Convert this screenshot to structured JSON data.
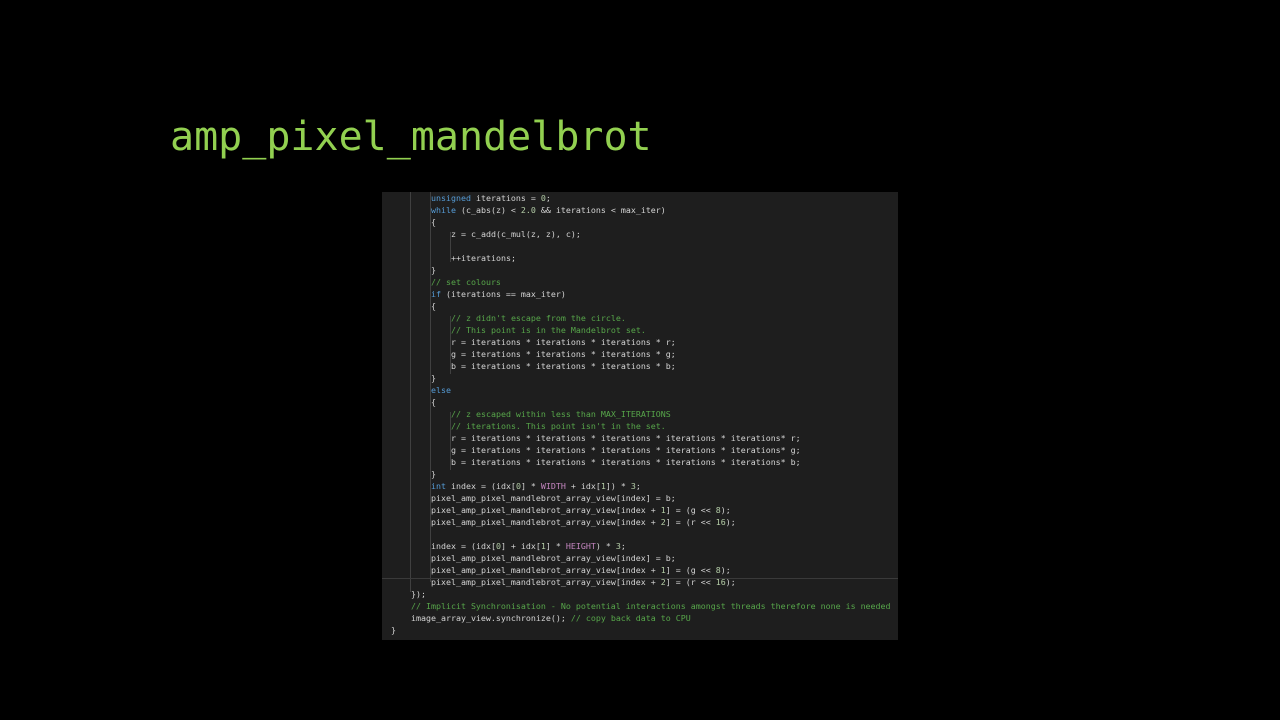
{
  "slide": {
    "title": "amp_pixel_mandelbrot"
  },
  "code": {
    "lines": [
      {
        "indent": 2,
        "tokens": [
          {
            "t": "unsigned",
            "c": "keyword"
          },
          {
            "t": " iterations = "
          },
          {
            "t": "0",
            "c": "number"
          },
          {
            "t": ";"
          }
        ]
      },
      {
        "indent": 2,
        "tokens": [
          {
            "t": "while",
            "c": "keyword"
          },
          {
            "t": " (c_abs(z) < "
          },
          {
            "t": "2.0",
            "c": "number"
          },
          {
            "t": " && iterations < max_iter)"
          }
        ]
      },
      {
        "indent": 2,
        "tokens": [
          {
            "t": "{"
          }
        ]
      },
      {
        "indent": 3,
        "tokens": [
          {
            "t": "z = c_add(c_mul(z, z), c);"
          }
        ]
      },
      {
        "indent": 3,
        "tokens": []
      },
      {
        "indent": 3,
        "tokens": [
          {
            "t": "++iterations;"
          }
        ]
      },
      {
        "indent": 2,
        "tokens": [
          {
            "t": "}"
          }
        ]
      },
      {
        "indent": 2,
        "tokens": [
          {
            "t": "// set colours",
            "c": "comment"
          }
        ]
      },
      {
        "indent": 2,
        "tokens": [
          {
            "t": "if",
            "c": "keyword"
          },
          {
            "t": " (iterations == max_iter)"
          }
        ]
      },
      {
        "indent": 2,
        "tokens": [
          {
            "t": "{"
          }
        ]
      },
      {
        "indent": 3,
        "tokens": [
          {
            "t": "// z didn't escape from the circle.",
            "c": "comment"
          }
        ]
      },
      {
        "indent": 3,
        "tokens": [
          {
            "t": "// This point is in the Mandelbrot set.",
            "c": "comment"
          }
        ]
      },
      {
        "indent": 3,
        "tokens": [
          {
            "t": "r = iterations * iterations * iterations * r;"
          }
        ]
      },
      {
        "indent": 3,
        "tokens": [
          {
            "t": "g = iterations * iterations * iterations * g;"
          }
        ]
      },
      {
        "indent": 3,
        "tokens": [
          {
            "t": "b = iterations * iterations * iterations * b;"
          }
        ]
      },
      {
        "indent": 2,
        "tokens": [
          {
            "t": "}"
          }
        ]
      },
      {
        "indent": 2,
        "tokens": [
          {
            "t": "else",
            "c": "keyword"
          }
        ]
      },
      {
        "indent": 2,
        "tokens": [
          {
            "t": "{"
          }
        ]
      },
      {
        "indent": 3,
        "tokens": [
          {
            "t": "// z escaped within less than MAX_ITERATIONS",
            "c": "comment"
          }
        ]
      },
      {
        "indent": 3,
        "tokens": [
          {
            "t": "// iterations. This point isn't in the set.",
            "c": "comment"
          }
        ]
      },
      {
        "indent": 3,
        "tokens": [
          {
            "t": "r = iterations * iterations * iterations * iterations * iterations* r;"
          }
        ]
      },
      {
        "indent": 3,
        "tokens": [
          {
            "t": "g = iterations * iterations * iterations * iterations * iterations* g;"
          }
        ]
      },
      {
        "indent": 3,
        "tokens": [
          {
            "t": "b = iterations * iterations * iterations * iterations * iterations* b;"
          }
        ]
      },
      {
        "indent": 2,
        "tokens": [
          {
            "t": "}"
          }
        ]
      },
      {
        "indent": 2,
        "tokens": [
          {
            "t": "int",
            "c": "keyword"
          },
          {
            "t": " index = (idx["
          },
          {
            "t": "0",
            "c": "number"
          },
          {
            "t": "] * "
          },
          {
            "t": "WIDTH",
            "c": "macro"
          },
          {
            "t": " + idx["
          },
          {
            "t": "1",
            "c": "number"
          },
          {
            "t": "]) * "
          },
          {
            "t": "3",
            "c": "number"
          },
          {
            "t": ";"
          }
        ]
      },
      {
        "indent": 2,
        "tokens": [
          {
            "t": "pixel_amp_pixel_mandlebrot_array_view[index] = b;"
          }
        ]
      },
      {
        "indent": 2,
        "tokens": [
          {
            "t": "pixel_amp_pixel_mandlebrot_array_view[index + "
          },
          {
            "t": "1",
            "c": "number"
          },
          {
            "t": "] = (g << "
          },
          {
            "t": "8",
            "c": "number"
          },
          {
            "t": ");"
          }
        ]
      },
      {
        "indent": 2,
        "tokens": [
          {
            "t": "pixel_amp_pixel_mandlebrot_array_view[index + "
          },
          {
            "t": "2",
            "c": "number"
          },
          {
            "t": "] = (r << "
          },
          {
            "t": "16",
            "c": "number"
          },
          {
            "t": ");"
          }
        ]
      },
      {
        "indent": 2,
        "tokens": []
      },
      {
        "indent": 2,
        "tokens": [
          {
            "t": "index = (idx["
          },
          {
            "t": "0",
            "c": "number"
          },
          {
            "t": "] + idx["
          },
          {
            "t": "1",
            "c": "number"
          },
          {
            "t": "] * "
          },
          {
            "t": "HEIGHT",
            "c": "macro"
          },
          {
            "t": ") * "
          },
          {
            "t": "3",
            "c": "number"
          },
          {
            "t": ";"
          }
        ]
      },
      {
        "indent": 2,
        "tokens": [
          {
            "t": "pixel_amp_pixel_mandlebrot_array_view[index] = b;"
          }
        ]
      },
      {
        "indent": 2,
        "tokens": [
          {
            "t": "pixel_amp_pixel_mandlebrot_array_view[index + "
          },
          {
            "t": "1",
            "c": "number"
          },
          {
            "t": "] = (g << "
          },
          {
            "t": "8",
            "c": "number"
          },
          {
            "t": ");"
          }
        ]
      },
      {
        "indent": 2,
        "tokens": [
          {
            "t": "pixel_amp_pixel_mandlebrot_array_view[index + "
          },
          {
            "t": "2",
            "c": "number"
          },
          {
            "t": "] = (r << "
          },
          {
            "t": "16",
            "c": "number"
          },
          {
            "t": ");"
          }
        ]
      },
      {
        "indent": 1,
        "tokens": [
          {
            "t": "});"
          }
        ]
      },
      {
        "indent": 1,
        "tokens": [
          {
            "t": "// Implicit Synchronisation - No potential interactions amongst threads therefore none is needed",
            "c": "comment"
          }
        ]
      },
      {
        "indent": 1,
        "tokens": [
          {
            "t": "image_array_view.synchronize(); "
          },
          {
            "t": "// copy back data to CPU",
            "c": "comment"
          }
        ]
      },
      {
        "indent": 0,
        "tokens": [
          {
            "t": "}"
          }
        ]
      }
    ]
  },
  "colors": {
    "title": "#92d050",
    "background": "#000000",
    "editor_background": "#1e1e1e",
    "keyword": "#569cd6",
    "comment": "#57a64a",
    "number": "#b5cea8",
    "macro": "#c586c0",
    "text": "#d4d4d4"
  }
}
